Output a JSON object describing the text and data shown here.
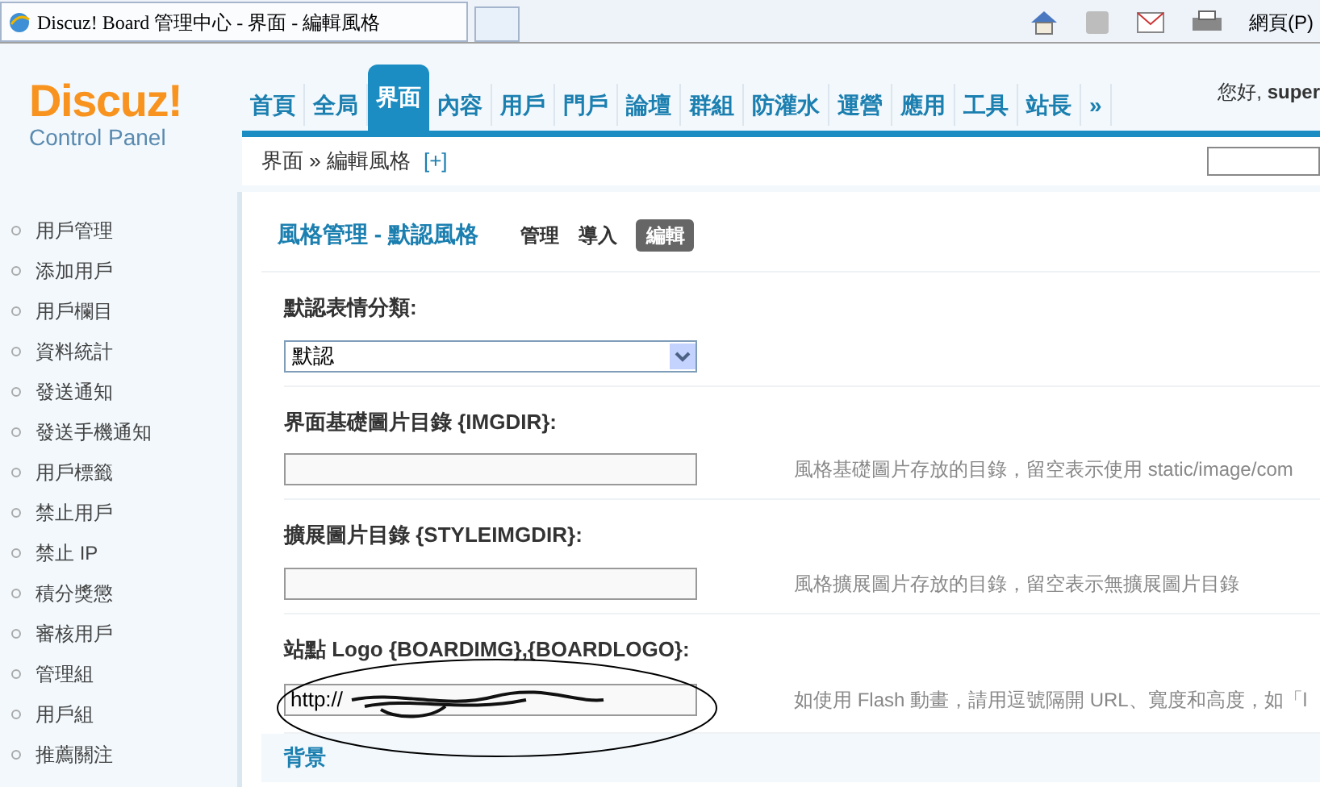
{
  "browser": {
    "tab_title": "Discuz! Board 管理中心 - 界面 - 編輯風格",
    "page_menu": "網頁(P)"
  },
  "header": {
    "logo": "Discuz!",
    "logo_sub": "Control Panel",
    "greeting": "您好, **super**",
    "nav": [
      {
        "label": "首頁",
        "selected": false
      },
      {
        "label": "全局",
        "selected": false
      },
      {
        "label": "界面",
        "selected": true
      },
      {
        "label": "內容",
        "selected": false
      },
      {
        "label": "用戶",
        "selected": false
      },
      {
        "label": "門戶",
        "selected": false
      },
      {
        "label": "論壇",
        "selected": false
      },
      {
        "label": "群組",
        "selected": false
      },
      {
        "label": "防灌水",
        "selected": false
      },
      {
        "label": "運營",
        "selected": false
      },
      {
        "label": "應用",
        "selected": false
      },
      {
        "label": "工具",
        "selected": false
      },
      {
        "label": "站長",
        "selected": false
      },
      {
        "label": "»",
        "selected": false
      }
    ],
    "breadcrumb": "界面 » 編輯風格",
    "breadcrumb_add": "[+]"
  },
  "sidebar": {
    "items": [
      "用戶管理",
      "添加用戶",
      "用戶欄目",
      "資料統計",
      "發送通知",
      "發送手機通知",
      "用戶標籤",
      "禁止用戶",
      "禁止 IP",
      "積分獎懲",
      "審核用戶",
      "管理組",
      "用戶組",
      "推薦關注"
    ]
  },
  "main": {
    "heading": "風格管理 - 默認風格",
    "tabs": [
      {
        "label": "管理",
        "selected": false
      },
      {
        "label": "導入",
        "selected": false
      },
      {
        "label": "編輯",
        "selected": true
      }
    ],
    "fields": [
      {
        "kind": "select",
        "label": "默認表情分類:",
        "value": "默認"
      },
      {
        "kind": "text",
        "label": "界面基礎圖片目錄 {IMGDIR}:",
        "hint": "風格基礎圖片存放的目錄，留空表示使用 static/image/com"
      },
      {
        "kind": "text",
        "label": "擴展圖片目錄 {STYLEIMGDIR}:",
        "hint": "風格擴展圖片存放的目錄，留空表示無擴展圖片目錄"
      },
      {
        "kind": "scribbled",
        "label": "站點 Logo {BOARDIMG},{BOARDLOGO}:",
        "value": "http://",
        "hint": "如使用 Flash 動畫，請用逗號隔開 URL、寬度和高度，如「l"
      }
    ],
    "group": "背景"
  }
}
